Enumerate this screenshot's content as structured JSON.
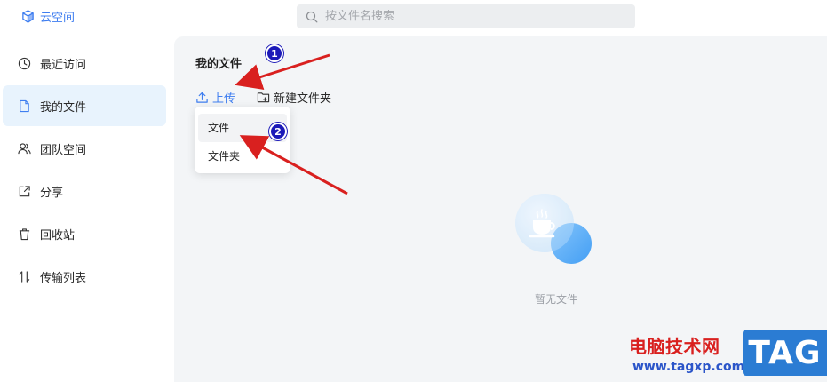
{
  "brand": {
    "name": "云空间",
    "icon": "cube-icon"
  },
  "search": {
    "placeholder": "按文件名搜索",
    "icon": "search-icon"
  },
  "sidebar": {
    "items": [
      {
        "label": "最近访问",
        "icon": "clock-icon",
        "active": false
      },
      {
        "label": "我的文件",
        "icon": "file-icon",
        "active": true
      },
      {
        "label": "团队空间",
        "icon": "team-icon",
        "active": false
      },
      {
        "label": "分享",
        "icon": "share-icon",
        "active": false
      },
      {
        "label": "回收站",
        "icon": "trash-icon",
        "active": false
      },
      {
        "label": "传输列表",
        "icon": "transfer-icon",
        "active": false
      }
    ]
  },
  "main": {
    "title": "我的文件",
    "toolbar": {
      "upload_label": "上传",
      "new_folder_label": "新建文件夹"
    },
    "upload_menu": {
      "items": [
        {
          "label": "文件"
        },
        {
          "label": "文件夹"
        }
      ]
    },
    "empty_state": {
      "text": "暂无文件",
      "icon": "coffee-cup-icon"
    }
  },
  "annotations": {
    "badges": [
      {
        "label": "1"
      },
      {
        "label": "2"
      }
    ],
    "color": "#1c1ab8",
    "arrow_color": "#d9201f"
  },
  "watermark": {
    "site_name": "电脑技术网",
    "url": "www.tagxp.com",
    "tag": "TAG"
  },
  "colors": {
    "accent": "#3f7ef0",
    "active_bg": "#e8f3fd",
    "panel_bg": "#f3f5f7"
  }
}
